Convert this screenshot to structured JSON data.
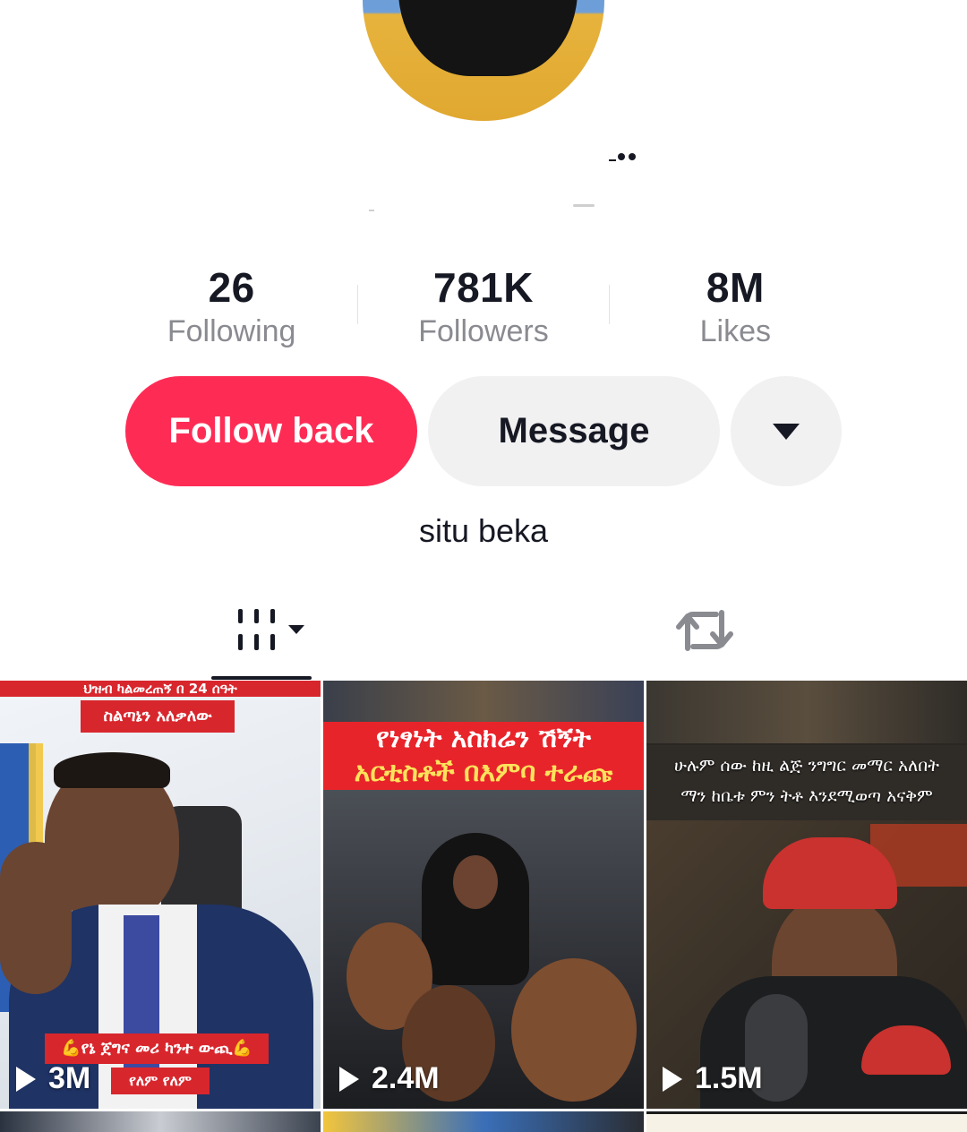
{
  "profile": {
    "stats": [
      {
        "value": "26",
        "label": "Following"
      },
      {
        "value": "781K",
        "label": "Followers"
      },
      {
        "value": "8M",
        "label": "Likes"
      }
    ],
    "bio": "situ beka"
  },
  "actions": {
    "follow_label": "Follow back",
    "message_label": "Message",
    "more_icon": "caret-down-icon"
  },
  "tabs": [
    {
      "name": "videos",
      "icon": "grid-icon",
      "selected": true
    },
    {
      "name": "reposts",
      "icon": "repost-icon",
      "selected": false
    }
  ],
  "videos": [
    {
      "views": "3M",
      "top_caption": "ህዝብ ካልመረጠኝ በ 24 ሰዓት",
      "top_caption2": "ስልጣኔን አለቃለው",
      "bottom_caption": "💪የኔ ጀግና መሪ ካንተ ውጪ💪",
      "bottom_caption2": "የለም የለም"
    },
    {
      "views": "2.4M",
      "top_caption": "የነፃነት አስክሬን ሽኝት",
      "top_caption2": "አርቲስቶች በእምባ ተራጩ"
    },
    {
      "views": "1.5M",
      "top_caption": "ሁሉም ሰው ከዚ ልጅ ንግግር መማር አለበት",
      "top_caption2": "ማን ከቤቱ ምን ትቶ እንደሚወጣ አናቅም"
    }
  ],
  "colors": {
    "accent": "#fe2c55",
    "secondary_bg": "#f1f1f2",
    "muted_text": "#8a8b91"
  }
}
